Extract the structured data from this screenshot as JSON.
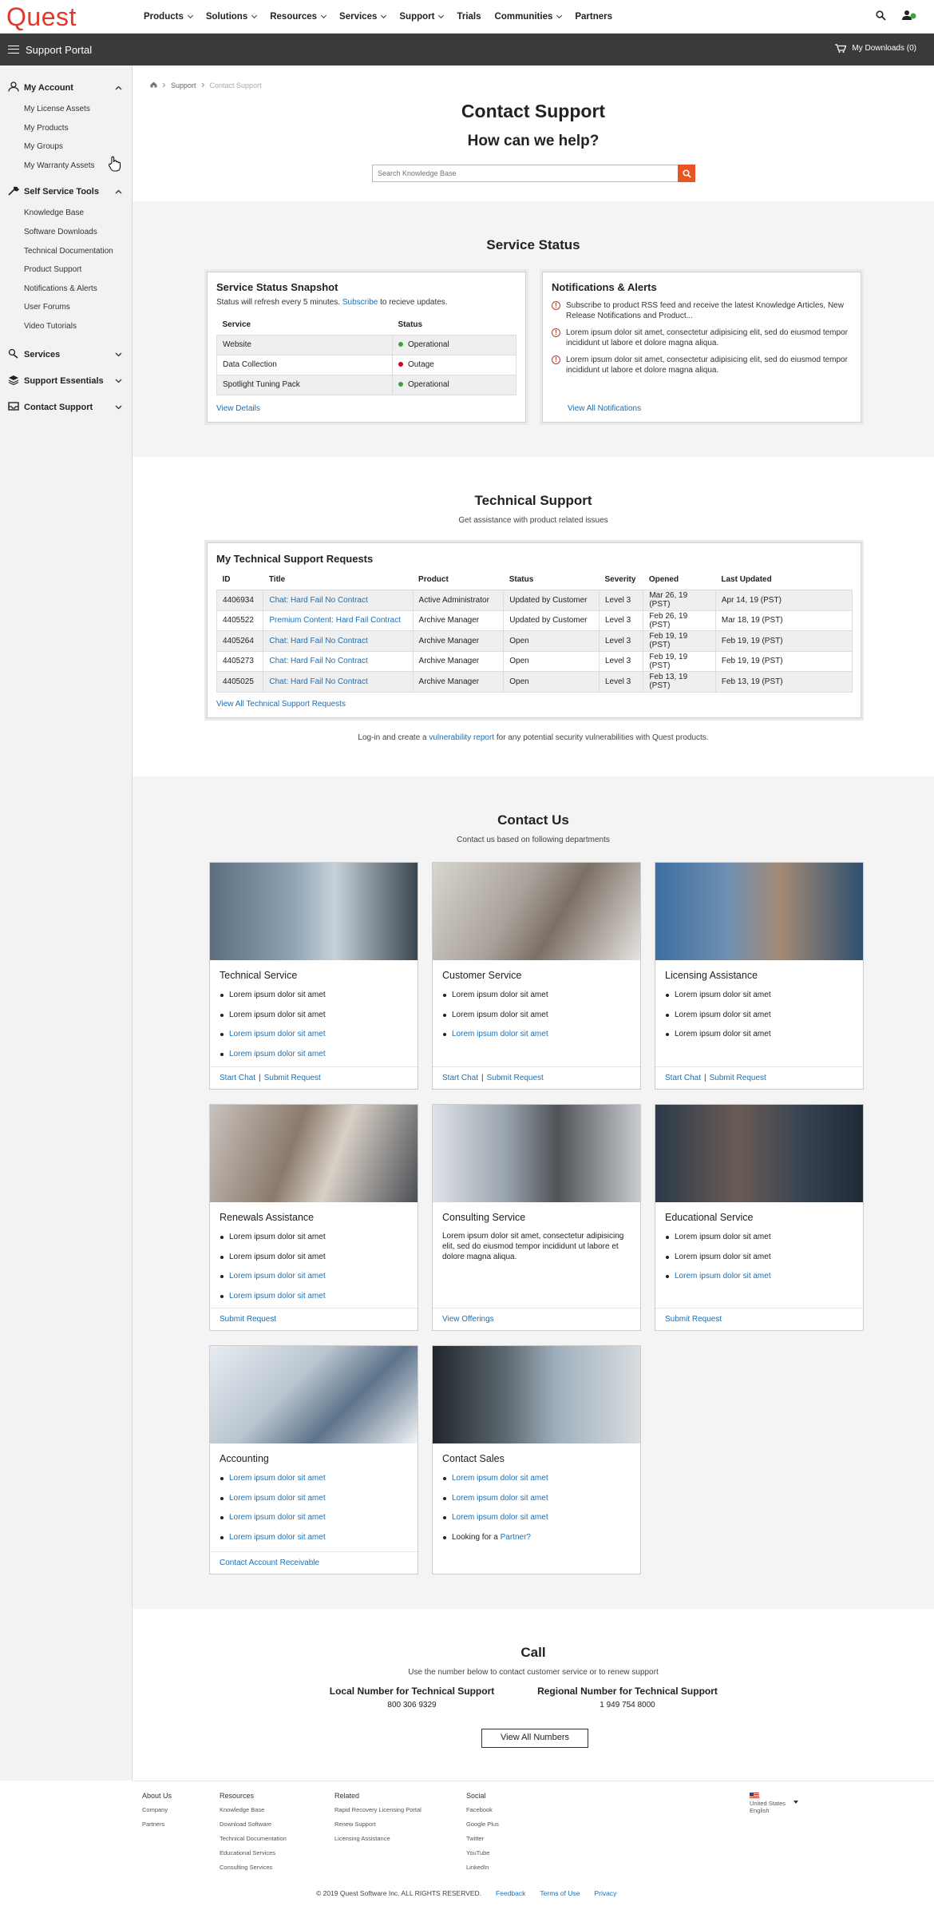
{
  "brand": {
    "logo": "Quest",
    "accent": "#e0382d",
    "search_btn": "#e95420"
  },
  "nav": {
    "items": [
      {
        "label": "Products",
        "has_menu": true
      },
      {
        "label": "Solutions",
        "has_menu": true
      },
      {
        "label": "Resources",
        "has_menu": true
      },
      {
        "label": "Services",
        "has_menu": true
      },
      {
        "label": "Support",
        "has_menu": true
      },
      {
        "label": "Trials",
        "has_menu": false
      },
      {
        "label": "Communities",
        "has_menu": true
      },
      {
        "label": "Partners",
        "has_menu": false
      }
    ]
  },
  "portalbar": {
    "title": "Support Portal",
    "downloads": "My Downloads (0)"
  },
  "sidebar": {
    "account": {
      "label": "My Account",
      "items": [
        "My License Assets",
        "My Products",
        "My Groups",
        "My Warranty Assets"
      ]
    },
    "tools": {
      "label": "Self Service Tools",
      "items": [
        "Knowledge Base",
        "Software Downloads",
        "Technical Documentation",
        "Product Support",
        "Notifications & Alerts",
        "User Forums",
        "Video Tutorials"
      ]
    },
    "services": "Services",
    "essentials": "Support Essentials",
    "contact": "Contact Support"
  },
  "breadcrumb": {
    "support": "Support",
    "current": "Contact Support"
  },
  "page": {
    "title": "Contact Support",
    "subtitle": "How can we help?",
    "search_placeholder": "Search Knowledge Base"
  },
  "service_status": {
    "title": "Service Status",
    "snapshot": {
      "title": "Service Status Snapshot",
      "note_pre": "Status will refresh every 5 minutes.",
      "subscribe": "Subscribe",
      "note_post": " to recieve updates.",
      "col_service": "Service",
      "col_status": "Status",
      "rows": [
        {
          "service": "Website",
          "status": "Operational",
          "color": "#3aa33a"
        },
        {
          "service": "Data Collection",
          "status": "Outage",
          "color": "#d0021b"
        },
        {
          "service": "Spotlight Tuning Pack",
          "status": "Operational",
          "color": "#3aa33a"
        }
      ],
      "link": "View Details"
    },
    "alerts": {
      "title": "Notifications & Alerts",
      "items": [
        "Subscribe to product RSS feed and receive the latest Knowledge Articles, New Release Notifications and Product...",
        "Lorem ipsum dolor sit amet, consectetur adipisicing elit, sed do eiusmod tempor incididunt ut labore et dolore magna aliqua.",
        "Lorem ipsum dolor sit amet, consectetur adipisicing elit, sed do eiusmod tempor incididunt ut labore et dolore magna aliqua."
      ],
      "link": "View All Notifications"
    }
  },
  "tech_support": {
    "title": "Technical Support",
    "subtitle": "Get assistance with product related issues",
    "table_title": "My Technical Support Requests",
    "headers": [
      "ID",
      "Title",
      "Product",
      "Status",
      "Severity",
      "Opened",
      "Last Updated"
    ],
    "rows": [
      [
        "4406934",
        "Chat: Hard Fail No Contract",
        "Active Administrator",
        "Updated by Customer",
        "Level 3",
        "Mar 26, 19 (PST)",
        "Apr 14, 19 (PST)"
      ],
      [
        "4405522",
        "Premium Content: Hard Fail Contract",
        "Archive Manager",
        "Updated by Customer",
        "Level 3",
        "Feb 26, 19 (PST)",
        "Mar 18, 19 (PST)"
      ],
      [
        "4405264",
        "Chat: Hard Fail No Contract",
        "Archive Manager",
        "Open",
        "Level 3",
        "Feb 19, 19 (PST)",
        "Feb 19, 19 (PST)"
      ],
      [
        "4405273",
        "Chat: Hard Fail No Contract",
        "Archive Manager",
        "Open",
        "Level 3",
        "Feb 19, 19 (PST)",
        "Feb 19, 19 (PST)"
      ],
      [
        "4405025",
        "Chat: Hard Fail No Contract",
        "Archive Manager",
        "Open",
        "Level 3",
        "Feb 13, 19 (PST)",
        "Feb 13, 19 (PST)"
      ]
    ],
    "link": "View All Technical Support Requests",
    "vuln_pre": "Log-in and create a ",
    "vuln_link": "vulnerability report",
    "vuln_post": " for any potential security vulnerabilities with Quest products."
  },
  "contact": {
    "title": "Contact Us",
    "subtitle": "Contact us based on following departments",
    "cards": [
      {
        "title": "Technical Service",
        "items": [
          {
            "t": "Lorem ipsum dolor sit amet",
            "link": false
          },
          {
            "t": "Lorem ipsum dolor sit amet",
            "link": false
          },
          {
            "t": "Lorem ipsum dolor sit amet",
            "link": true
          },
          {
            "t": "Lorem ipsum dolor sit amet",
            "link": true
          }
        ],
        "foot": [
          "Start Chat",
          "Submit Request"
        ]
      },
      {
        "title": "Customer Service",
        "items": [
          {
            "t": "Lorem ipsum dolor sit amet",
            "link": false
          },
          {
            "t": "Lorem ipsum dolor sit amet",
            "link": false
          },
          {
            "t": "Lorem ipsum dolor sit amet",
            "link": true
          }
        ],
        "foot": [
          "Start Chat",
          "Submit Request"
        ]
      },
      {
        "title": "Licensing Assistance",
        "items": [
          {
            "t": "Lorem ipsum dolor sit amet",
            "link": false
          },
          {
            "t": "Lorem ipsum dolor sit amet",
            "link": false
          },
          {
            "t": "Lorem ipsum dolor sit amet",
            "link": false
          }
        ],
        "foot": [
          "Start Chat",
          "Submit Request"
        ]
      },
      {
        "title": "Renewals Assistance",
        "items": [
          {
            "t": "Lorem ipsum dolor sit amet",
            "link": false
          },
          {
            "t": "Lorem ipsum dolor sit amet",
            "link": false
          },
          {
            "t": "Lorem ipsum dolor sit amet",
            "link": true
          },
          {
            "t": "Lorem ipsum dolor sit amet",
            "link": true
          }
        ],
        "foot": [
          "Submit Request"
        ]
      },
      {
        "title": "Consulting Service",
        "para": "Lorem ipsum dolor sit amet, consectetur adipisicing elit, sed do eiusmod tempor incididunt ut labore et dolore magna aliqua.",
        "foot": [
          "View Offerings"
        ]
      },
      {
        "title": "Educational Service",
        "items": [
          {
            "t": "Lorem ipsum dolor sit amet",
            "link": false
          },
          {
            "t": "Lorem ipsum dolor sit amet",
            "link": false
          },
          {
            "t": "Lorem ipsum dolor sit amet",
            "link": true
          }
        ],
        "foot": [
          "Submit Request"
        ]
      },
      {
        "title": "Accounting",
        "items": [
          {
            "t": "Lorem ipsum dolor sit amet",
            "link": true
          },
          {
            "t": "Lorem ipsum dolor sit amet",
            "link": true
          },
          {
            "t": "Lorem ipsum dolor sit amet",
            "link": true
          },
          {
            "t": "Lorem ipsum dolor sit amet",
            "link": true
          }
        ],
        "foot": [
          "Contact Account Receivable"
        ]
      },
      {
        "title": "Contact Sales",
        "items": [
          {
            "t": "Lorem ipsum dolor sit amet",
            "link": true
          },
          {
            "t": "Lorem ipsum dolor sit amet",
            "link": true
          },
          {
            "t": "Lorem ipsum dolor sit amet",
            "link": true
          }
        ],
        "partner_pre": "Looking for a ",
        "partner_link": "Partner?",
        "foot": []
      }
    ]
  },
  "call": {
    "title": "Call",
    "subtitle": "Use the number below to contact customer service or to renew support",
    "local_label": "Local Number for Technical Support",
    "local_num": "800 306 9329",
    "regional_label": "Regional Number for Technical Support",
    "regional_num": "1 949 754 8000",
    "button": "View All Numbers"
  },
  "footer": {
    "about": {
      "title": "About Us",
      "items": [
        "Company",
        "Partners"
      ]
    },
    "resources": {
      "title": "Resources",
      "items": [
        "Knowledge Base",
        "Download Software",
        "Technical Documentation",
        "Educational Services",
        "Consulting Services"
      ]
    },
    "related": {
      "title": "Related",
      "items": [
        "Rapid Recovery Licensing Portal",
        "Renew Support",
        "Licensing Assistance"
      ]
    },
    "social": {
      "title": "Social",
      "items": [
        "Facebook",
        "Google Plus",
        "Twitter",
        "YouTube",
        "LinkedIn"
      ]
    },
    "locale": {
      "country": "United States",
      "language": "English"
    },
    "copyright": "© 2019 Quest Software Inc. ALL RIGHTS RESERVED.",
    "links": [
      "Feedback",
      "Terms of Use",
      "Privacy"
    ]
  }
}
